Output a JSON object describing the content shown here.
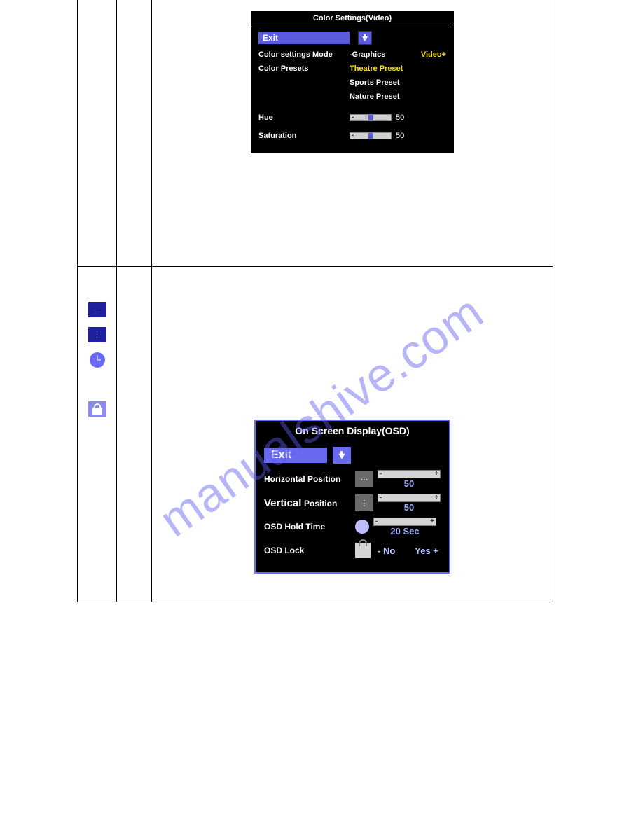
{
  "watermark": "manualshive.com",
  "panel_color": {
    "title": "Color Settings(Video)",
    "exit": "Exit",
    "mode_label": "Color settings Mode",
    "mode_graphics": "-Graphics",
    "mode_video": "Video+",
    "presets_label": "Color Presets",
    "preset_theatre": "Theatre Preset",
    "preset_sports": "Sports Preset",
    "preset_nature": "Nature Preset",
    "hue_label": "Hue",
    "hue_value": "50",
    "sat_label": "Saturation",
    "sat_value": "50"
  },
  "panel_osd": {
    "title": "On Screen Display(OSD)",
    "exit": "Exit",
    "hpos_label": "Horizontal Position",
    "hpos_value": "50",
    "vpos_label_a": "Vertical",
    "vpos_label_b": "Position",
    "vpos_value": "50",
    "hold_label": "OSD Hold Time",
    "hold_value": "20 Sec",
    "lock_label": "OSD Lock",
    "lock_no": "- No",
    "lock_yes": "Yes +"
  }
}
